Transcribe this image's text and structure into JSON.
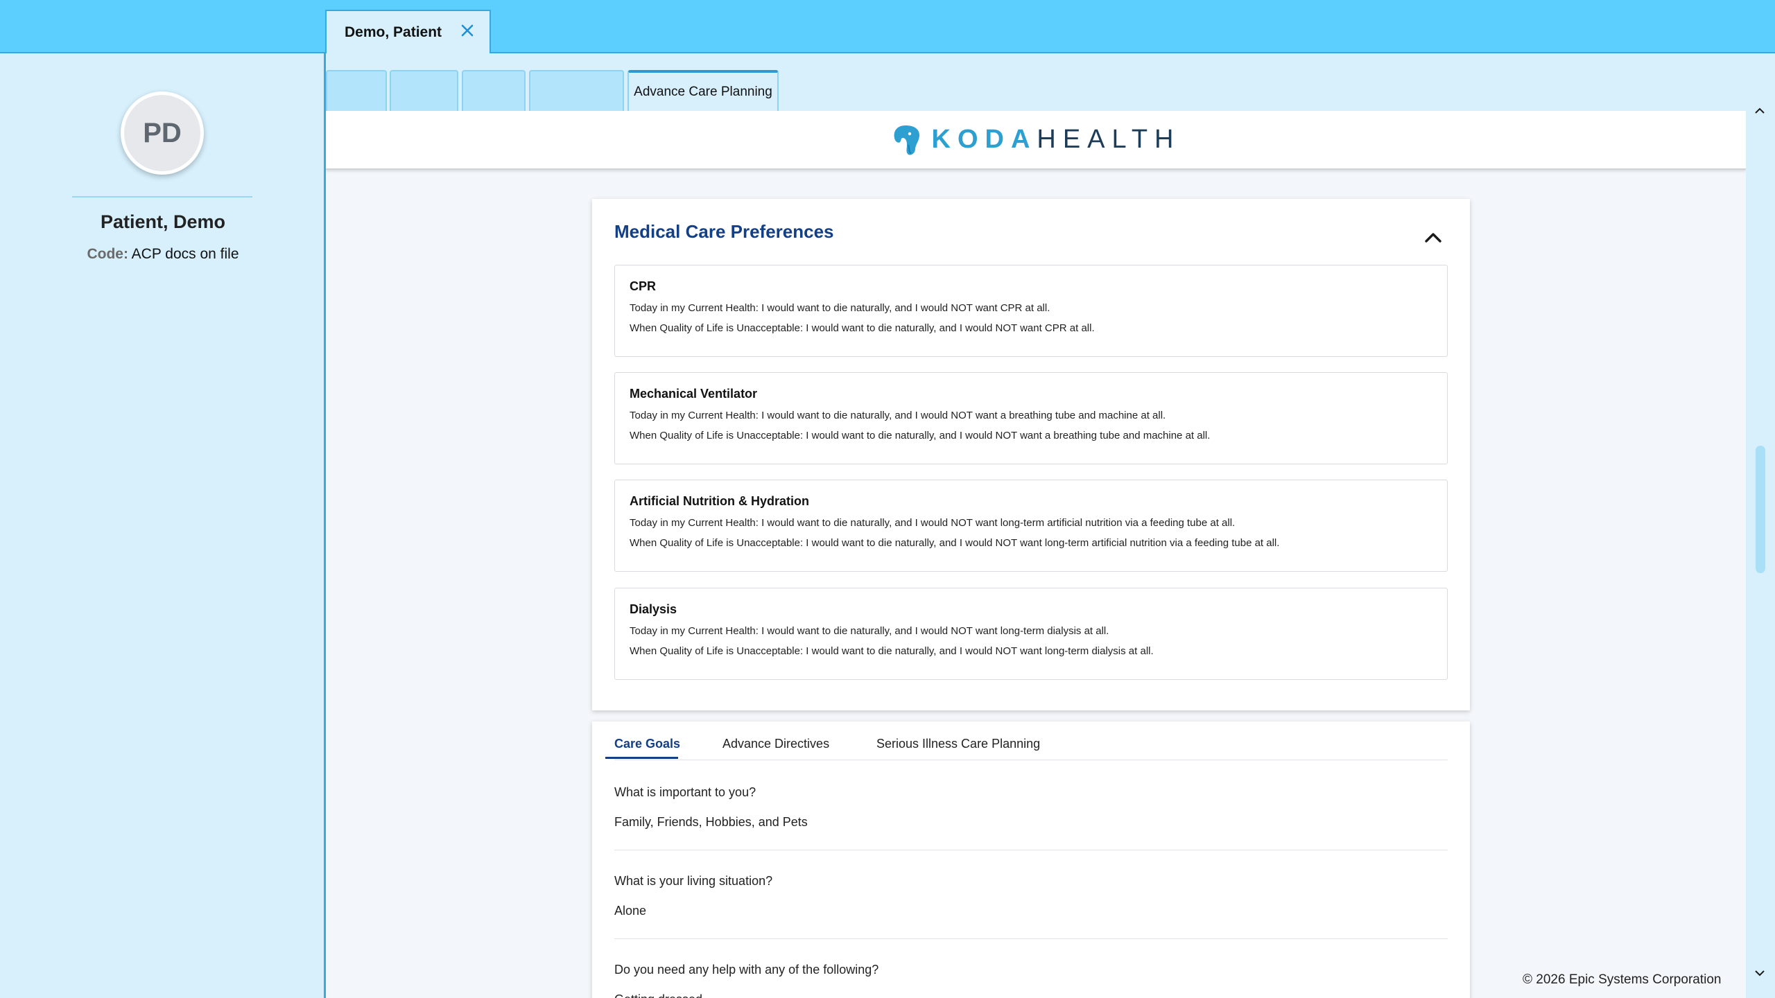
{
  "header": {
    "patient_tab_label": "Demo, Patient"
  },
  "sidebar": {
    "avatar_initials": "PD",
    "patient_name": "Patient, Demo",
    "code_label": "Code:",
    "code_value": "ACP docs on file"
  },
  "activity_tabs": {
    "active_label": "Advance Care Planning"
  },
  "logo": {
    "koda": "KODA",
    "health": "HEALTH"
  },
  "preferences": {
    "title": "Medical Care Preferences",
    "items": [
      {
        "title": "CPR",
        "current": "Today in my Current Health: I would want to die naturally, and I would NOT want CPR at all.",
        "unacceptable": "When Quality of Life is Unacceptable: I would want to die naturally, and I would NOT want CPR at all."
      },
      {
        "title": "Mechanical Ventilator",
        "current": "Today in my Current Health: I would want to die naturally, and I would NOT want a breathing tube and machine at all.",
        "unacceptable": "When Quality of Life is Unacceptable: I would want to die naturally, and I would NOT want a breathing tube and machine at all."
      },
      {
        "title": "Artificial Nutrition & Hydration",
        "current": "Today in my Current Health: I would want to die naturally, and I would NOT want long-term artificial nutrition via a feeding tube at all.",
        "unacceptable": "When Quality of Life is Unacceptable: I would want to die naturally, and I would NOT want long-term artificial nutrition via a feeding tube at all."
      },
      {
        "title": "Dialysis",
        "current": "Today in my Current Health: I would want to die naturally, and I would NOT want long-term dialysis at all.",
        "unacceptable": "When Quality of Life is Unacceptable: I would want to die naturally, and I would NOT want long-term dialysis at all."
      }
    ]
  },
  "goals": {
    "tabs": [
      "Care Goals",
      "Advance Directives",
      "Serious Illness Care Planning"
    ],
    "active_tab": "Care Goals",
    "qa": [
      {
        "question": "What is important to you?",
        "answer": "Family, Friends, Hobbies, and Pets"
      },
      {
        "question": "What is your living situation?",
        "answer": "Alone"
      },
      {
        "question": "Do you need any help with any of the following?",
        "answer": "Getting dressed"
      }
    ]
  },
  "footer": {
    "copyright": "© 2026 Epic Systems Corporation"
  },
  "colors": {
    "topbar": "#5ccfff",
    "sidebar_bg": "#d7f0fc",
    "accent_blue": "#123f86",
    "logo_koda": "#2d9fd0",
    "logo_health": "#1d3c57"
  }
}
